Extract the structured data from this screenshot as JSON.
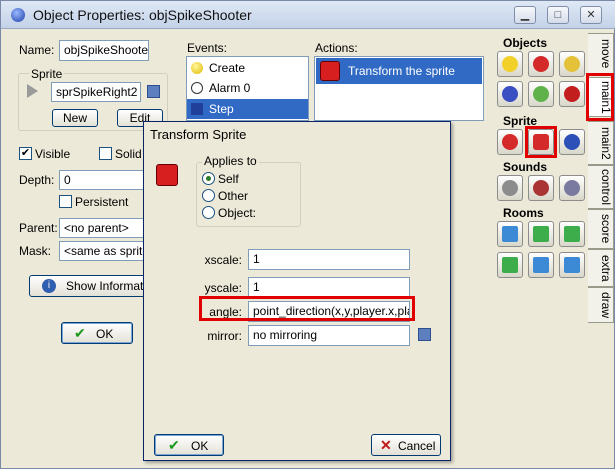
{
  "window": {
    "title": "Object Properties: objSpikeShooter"
  },
  "left": {
    "name_label": "Name:",
    "name_value": "objSpikeShooter",
    "sprite_label": "Sprite",
    "sprite_value": "sprSpikeRight2",
    "new_label": "New",
    "edit_label": "Edit",
    "visible_label": "Visible",
    "solid_label": "Solid",
    "depth_label": "Depth:",
    "depth_value": "0",
    "persistent_label": "Persistent",
    "parent_label": "Parent:",
    "parent_value": "<no parent>",
    "mask_label": "Mask:",
    "mask_value": "<same as sprite>",
    "show_info_label": "Show Information",
    "ok_label": "OK"
  },
  "events": {
    "header": "Events:",
    "items": [
      "Create",
      "Alarm 0",
      "Step"
    ]
  },
  "actions": {
    "header": "Actions:",
    "items": [
      "Transform the sprite"
    ]
  },
  "palette": {
    "objects_label": "Objects",
    "sprite_label": "Sprite",
    "sounds_label": "Sounds",
    "rooms_label": "Rooms",
    "tabs": [
      "move",
      "main1",
      "main2",
      "control",
      "score",
      "extra",
      "draw"
    ]
  },
  "dialog": {
    "title": "Transform Sprite",
    "applies_to_label": "Applies to",
    "options": [
      "Self",
      "Other",
      "Object:"
    ],
    "xscale_label": "xscale:",
    "xscale_value": "1",
    "yscale_label": "yscale:",
    "yscale_value": "1",
    "angle_label": "angle:",
    "angle_value": "point_direction(x,y,player.x,player",
    "mirror_label": "mirror:",
    "mirror_value": "no mirroring",
    "ok_label": "OK",
    "cancel_label": "Cancel"
  }
}
